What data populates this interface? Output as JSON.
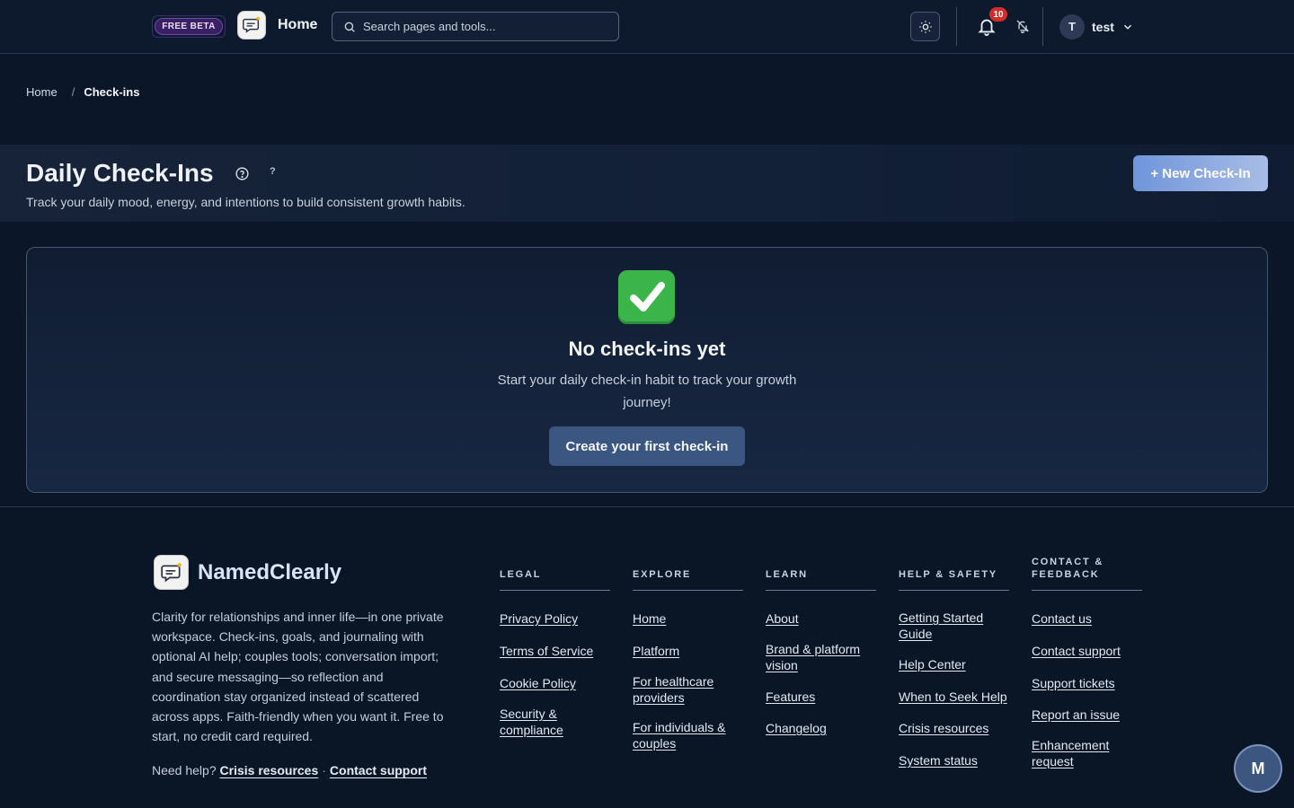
{
  "topbar": {
    "beta_label": "FREE BETA",
    "title": "Home",
    "search_placeholder": "Search pages and tools...",
    "notification_count": "10",
    "user_initial": "T",
    "username": "test"
  },
  "breadcrumb": {
    "home": "Home",
    "separator": "/",
    "current": "Check-ins"
  },
  "header": {
    "title": "Daily Check-Ins",
    "help_mark": "?",
    "subtitle": "Track your daily mood, energy, and intentions to build consistent growth habits.",
    "new_button": "+ New Check-In"
  },
  "empty_state": {
    "title": "No check-ins yet",
    "description": "Start your daily check-in habit to track your growth journey!",
    "button": "Create your first check-in"
  },
  "footer": {
    "brand": "NamedClearly",
    "description": "Clarity for relationships and inner life—in one private workspace. Check-ins, goals, and journaling with optional AI help; couples tools; conversation import; and secure messaging—so reflection and coordination stay organized instead of scattered across apps. Faith-friendly when you want it. Free to start, no credit card required.",
    "need_help": "Need help?",
    "crisis_link": "Crisis resources",
    "dot": "·",
    "support_link": "Contact support",
    "columns": [
      {
        "heading": "LEGAL",
        "links": [
          "Privacy Policy",
          "Terms of Service",
          "Cookie Policy",
          "Security & compliance"
        ]
      },
      {
        "heading": "EXPLORE",
        "links": [
          "Home",
          "Platform",
          "For healthcare providers",
          "For individuals & couples"
        ]
      },
      {
        "heading": "LEARN",
        "links": [
          "About",
          "Brand & platform vision",
          "Features",
          "Changelog"
        ]
      },
      {
        "heading": "HELP & SAFETY",
        "links": [
          "Getting Started Guide",
          "Help Center",
          "When to Seek Help",
          "Crisis resources",
          "System status"
        ]
      },
      {
        "heading": "CONTACT & FEEDBACK",
        "links": [
          "Contact us",
          "Contact support",
          "Support tickets",
          "Report an issue",
          "Enhancement request"
        ]
      }
    ]
  },
  "chat_fab": {
    "label": "M"
  },
  "colors": {
    "background": "#0b1628",
    "accent": "#6f95da",
    "button": "#3b5680",
    "badge": "#d42b2b",
    "success": "#3bb54a"
  },
  "icons": [
    "chat-logo-icon",
    "search-icon",
    "sun-icon",
    "bell-icon",
    "bell-off-icon",
    "chevron-down-icon",
    "help-circle-icon",
    "check-mark-icon"
  ]
}
